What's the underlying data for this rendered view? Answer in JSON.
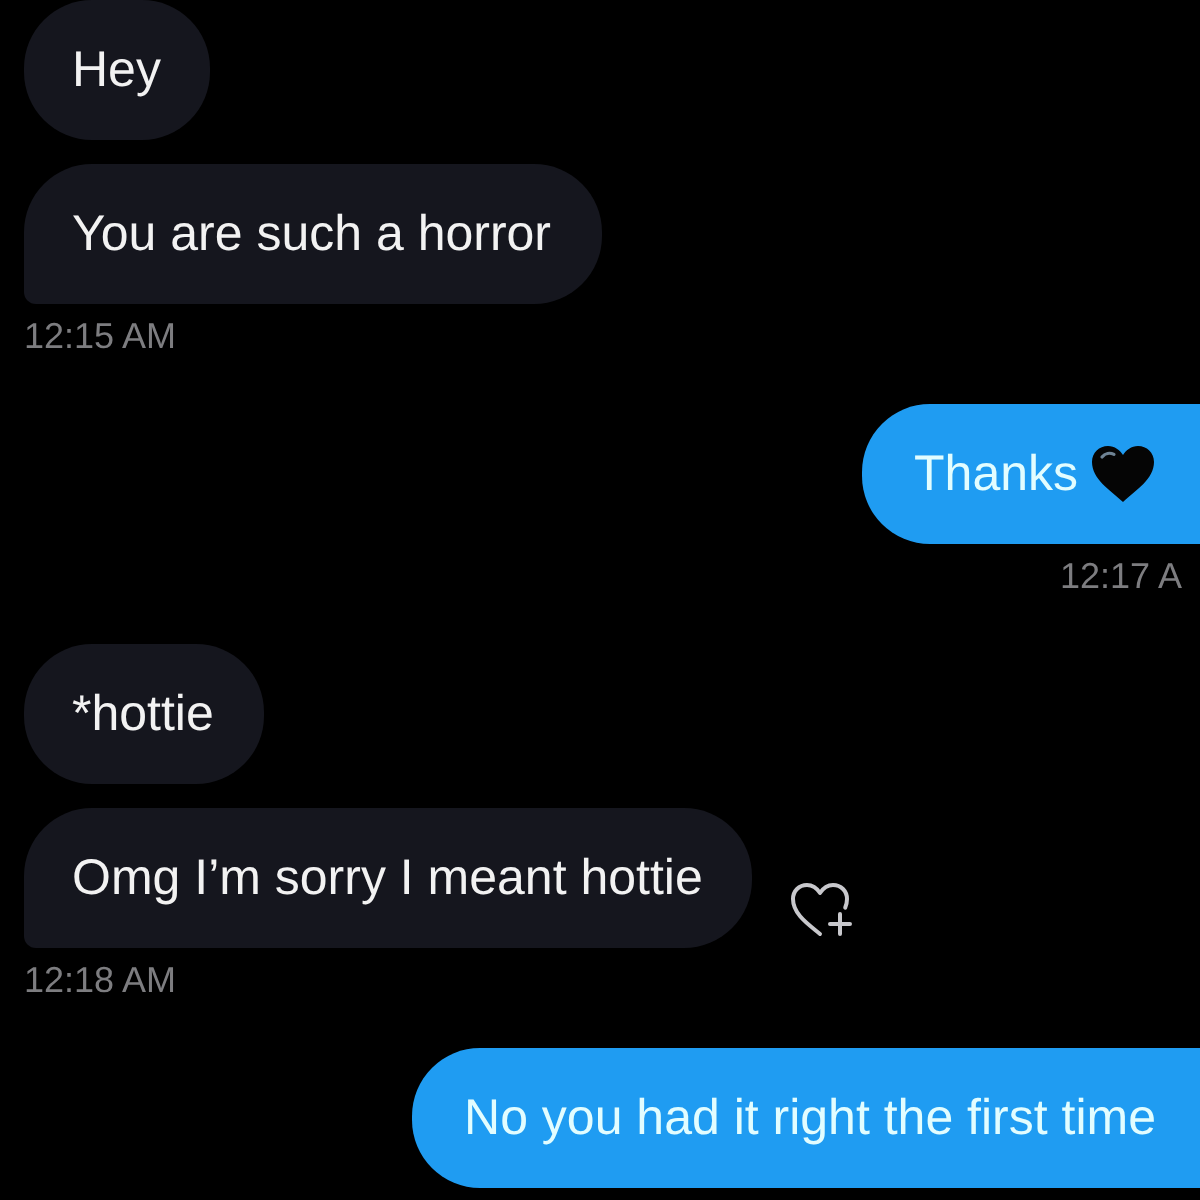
{
  "conversation": [
    {
      "kind": "incoming",
      "messages": [
        {
          "text": "Hey",
          "heart": false,
          "react_button": false
        },
        {
          "text": "You are such a horror",
          "heart": false,
          "react_button": false
        }
      ],
      "time": "12:15 AM"
    },
    {
      "kind": "outgoing",
      "messages": [
        {
          "text": "Thanks",
          "heart": true,
          "react_button": false
        }
      ],
      "time": "12:17 A"
    },
    {
      "kind": "incoming",
      "messages": [
        {
          "text": "*hottie",
          "heart": false,
          "react_button": false
        },
        {
          "text": "Omg I’m sorry I meant hottie",
          "heart": false,
          "react_button": true
        }
      ],
      "time": "12:18 AM"
    },
    {
      "kind": "outgoing",
      "messages": [
        {
          "text": "No you had it right the first time",
          "heart": false,
          "react_button": false
        }
      ]
    }
  ]
}
